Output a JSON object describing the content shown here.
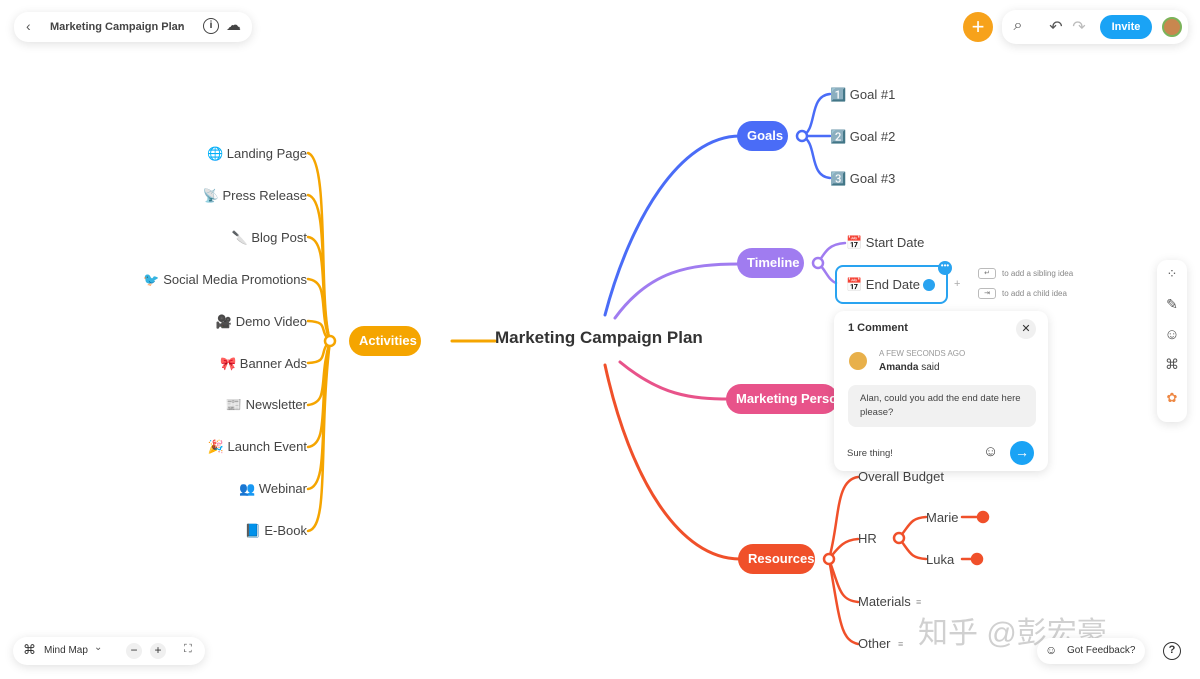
{
  "header": {
    "back_icon": "chevron-left-icon",
    "title": "Marketing Campaign Plan",
    "info_icon": "info-icon",
    "cloud_icon": "cloud-download-icon"
  },
  "topbar": {
    "add_icon": "plus-icon",
    "search_icon": "search-icon",
    "undo_icon": "undo-icon",
    "redo_icon": "redo-icon",
    "invite_label": "Invite",
    "accent": "#f7a21b",
    "invite_color": "#1aa3f5"
  },
  "map": {
    "center": "Marketing Campaign Plan",
    "activities": {
      "label": "Activities",
      "color": "#f5a500",
      "items": [
        "🌐 Landing Page",
        "📡 Press Release",
        "🔪 Blog Post",
        "🐦 Social Media Promotions",
        "🎥 Demo Video",
        "🎀 Banner Ads",
        "📰 Newsletter",
        "🎉 Launch Event",
        "👥 Webinar",
        "📘 E-Book"
      ]
    },
    "goals": {
      "label": "Goals",
      "color": "#4a6cf7",
      "items": [
        "1️⃣ Goal #1",
        "2️⃣ Goal #2",
        "3️⃣ Goal #3"
      ]
    },
    "timeline": {
      "label": "Timeline",
      "color": "#a07cf0",
      "items": [
        "📅 Start Date",
        "📅 End Date"
      ]
    },
    "persona": {
      "label": "Marketing Persona",
      "color": "#e8538a"
    },
    "resources": {
      "label": "Resources",
      "color": "#f0502a",
      "items": [
        "Overall Budget",
        "HR",
        "Materials",
        "Other"
      ],
      "hr_items": [
        "Marie",
        "Luka"
      ]
    }
  },
  "hints": {
    "sibling_key": "↵",
    "sibling": "to add a sibling idea",
    "child_key": "⇥",
    "child": "to add a child idea"
  },
  "comment": {
    "title": "1 Comment",
    "time": "A FEW SECONDS AGO",
    "author": "Amanda",
    "said": "said",
    "text": "Alan, could you add the end date here please?",
    "reply": "Sure thing!"
  },
  "bottom": {
    "view_label": "Mind Map",
    "zoom_out": "−",
    "zoom_in": "+",
    "feedback": "Got Feedback?",
    "help": "?"
  },
  "watermark": "知乎 @彭宏豪"
}
